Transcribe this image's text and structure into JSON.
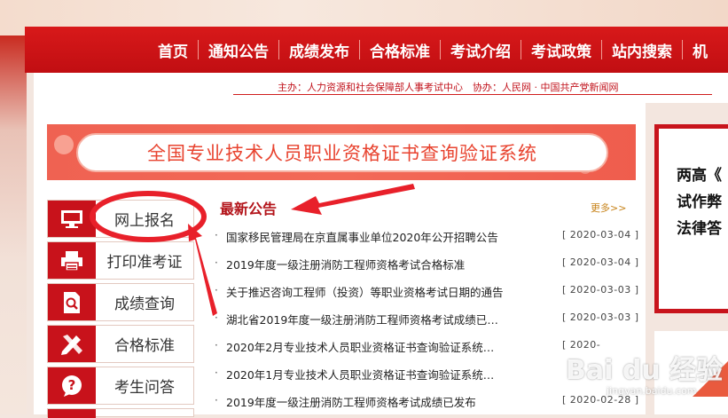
{
  "nav": {
    "items": [
      "首页",
      "通知公告",
      "成绩发布",
      "合格标准",
      "考试介绍",
      "考试政策",
      "站内搜索",
      "机"
    ]
  },
  "credits": "主办：人力资源和社会保障部人事考试中心　协办：人民网 · 中国共产党新闻网",
  "banner": {
    "title": "全国专业技术人员职业资格证书查询验证系统"
  },
  "sidebar": {
    "items": [
      {
        "label": "网上报名",
        "icon": "monitor-icon"
      },
      {
        "label": "打印准考证",
        "icon": "printer-icon"
      },
      {
        "label": "成绩查询",
        "icon": "search-document-icon"
      },
      {
        "label": "合格标准",
        "icon": "pencil-ruler-icon"
      },
      {
        "label": "考生问答",
        "icon": "question-icon"
      }
    ]
  },
  "notices": {
    "title": "最新公告",
    "more": "更多>>",
    "items": [
      {
        "text": "国家移民管理局在京直属事业单位2020年公开招聘公告",
        "date": "[ 2020-03-04 ]"
      },
      {
        "text": "2019年度一级注册消防工程师资格考试合格标准",
        "date": "[ 2020-03-04 ]"
      },
      {
        "text": "关于推迟咨询工程师（投资）等职业资格考试日期的通告",
        "date": "[ 2020-03-03 ]"
      },
      {
        "text": "湖北省2019年度一级注册消防工程师资格考试成绩已…",
        "date": "[ 2020-03-03 ]"
      },
      {
        "text": "2020年2月专业技术人员职业资格证书查询验证系统…",
        "date": "[ 2020-"
      },
      {
        "text": "2020年1月专业技术人员职业资格证书查询验证系统…",
        "date": ""
      },
      {
        "text": "2019年度一级注册消防工程师资格考试成绩已发布",
        "date": "[ 2020-02-28 ]"
      }
    ]
  },
  "right_panel": {
    "lines": [
      "两高《",
      "试作弊",
      "法律答"
    ]
  },
  "watermark": {
    "main": "Bai du 经验",
    "sub": "jingyan.baidu.com"
  },
  "colors": {
    "nav_red": "#c8121b",
    "annotation_red": "#e8202a",
    "title_red": "#b3141a"
  }
}
